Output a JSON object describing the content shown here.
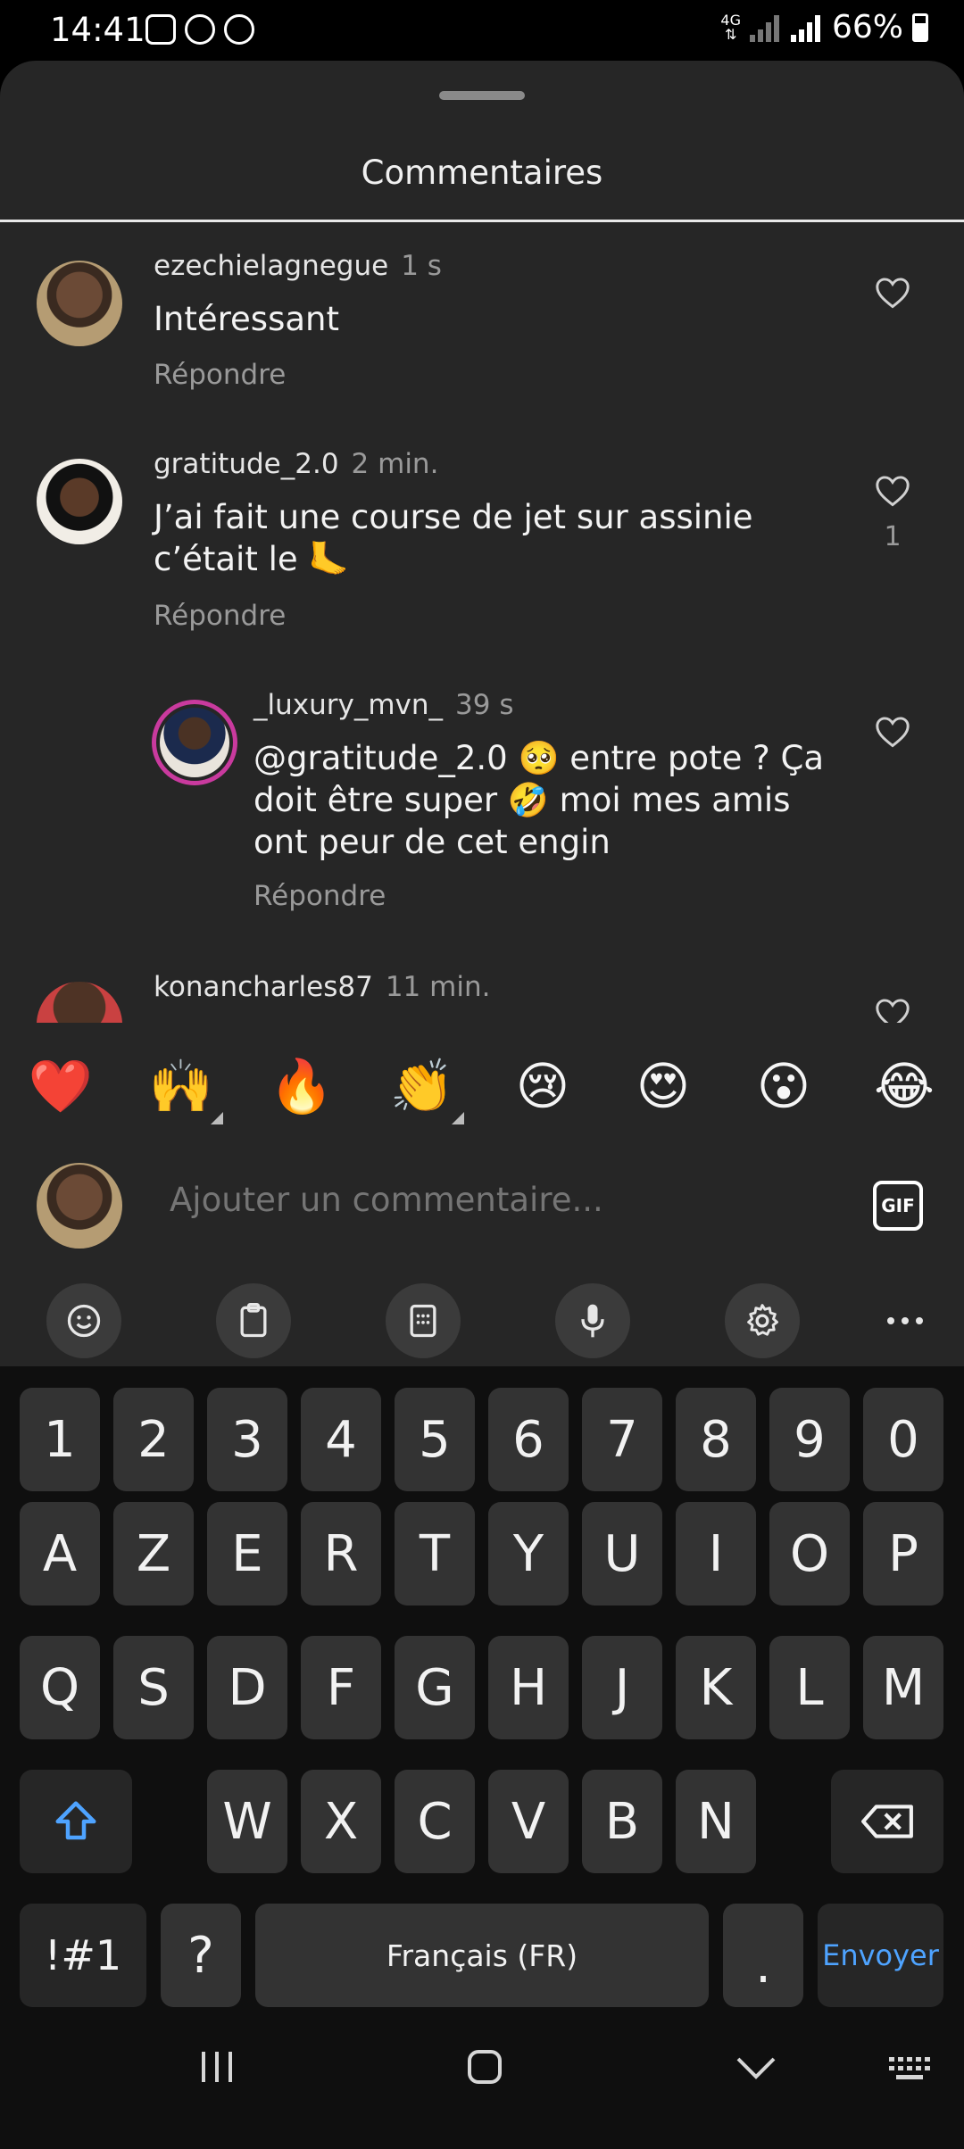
{
  "status": {
    "time": "14:41",
    "network": "4G",
    "battery": "66%"
  },
  "sheet": {
    "title": "Commentaires"
  },
  "comments": [
    {
      "username": "ezechielagnegue",
      "time": "1 s",
      "text": "Intéressant",
      "reply_label": "Répondre",
      "likes": ""
    },
    {
      "username": "gratitude_2.0",
      "time": "2 min.",
      "text": "J’ai fait une course de jet sur assinie c’était le 🦶",
      "reply_label": "Répondre",
      "likes": "1"
    },
    {
      "username": "_luxury_mvn_",
      "time": "39 s",
      "text": "@gratitude_2.0 🥺 entre pote ? Ça doit être super 🤣 moi mes amis ont peur de cet engin",
      "reply_label": "Répondre",
      "likes": ""
    },
    {
      "username": "konancharles87",
      "time": "11 min.",
      "text": "",
      "reply_label": "",
      "likes": ""
    }
  ],
  "reactions": [
    "❤️",
    "🙌",
    "🔥",
    "👏",
    "😢",
    "😍",
    "😮",
    "😂"
  ],
  "composer": {
    "placeholder": "Ajouter un commentaire...",
    "gif_label": "GIF"
  },
  "keyboard": {
    "row_numbers": [
      "1",
      "2",
      "3",
      "4",
      "5",
      "6",
      "7",
      "8",
      "9",
      "0"
    ],
    "row_1": [
      "A",
      "Z",
      "E",
      "R",
      "T",
      "Y",
      "U",
      "I",
      "O",
      "P"
    ],
    "row_2": [
      "Q",
      "S",
      "D",
      "F",
      "G",
      "H",
      "J",
      "K",
      "L",
      "M"
    ],
    "row_3": [
      "W",
      "X",
      "C",
      "V",
      "B",
      "N"
    ],
    "symbols_label": "!#1",
    "question_label": "?",
    "space_label": "Français (FR)",
    "period_label": ".",
    "send_label": "Envoyer"
  },
  "colors": {
    "background": "#262626",
    "keyboard": "#0f0f0f",
    "key": "#333333",
    "accent": "#4ea3ff",
    "muted_text": "#9a9a9a"
  }
}
